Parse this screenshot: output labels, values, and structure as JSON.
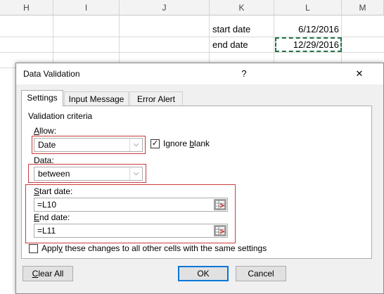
{
  "sheet": {
    "columns": [
      "H",
      "I",
      "J",
      "K",
      "L",
      "M"
    ],
    "rows": [
      {
        "label": "start date",
        "value": "6/12/2016"
      },
      {
        "label": "end date",
        "value": "12/29/2016"
      }
    ]
  },
  "dialog": {
    "title": "Data Validation",
    "help": "?",
    "close": "✕",
    "tabs": [
      "Settings",
      "Input Message",
      "Error Alert"
    ],
    "group_label": "Validation criteria",
    "allow": {
      "label_key": "A",
      "label_rest": "llow:",
      "value": "Date"
    },
    "ignore_blank": {
      "checked": true,
      "label_pre": "Ignore ",
      "label_key": "b",
      "label_post": "lank",
      "check_glyph": "✓"
    },
    "data": {
      "label_key": "D",
      "label_rest": "ata:",
      "value": "between"
    },
    "start": {
      "label_key": "S",
      "label_rest": "tart date:",
      "value": "=L10"
    },
    "end": {
      "label_key": "E",
      "label_rest": "nd date:",
      "value": "=L11"
    },
    "apply_all": {
      "checked": false,
      "label_pre": "Appl",
      "label_key": "y",
      "label_post": " these changes to all other cells with the same settings"
    },
    "buttons": {
      "clear_key": "C",
      "clear_rest": "lear All",
      "ok": "OK",
      "cancel": "Cancel"
    },
    "icons": {
      "dropdown": "chevron-down-icon",
      "range_ref": "range-selector-icon"
    },
    "colors": {
      "highlight": "#cc3b3b",
      "accent": "#0078d7",
      "copy_marquee": "#217346"
    }
  }
}
